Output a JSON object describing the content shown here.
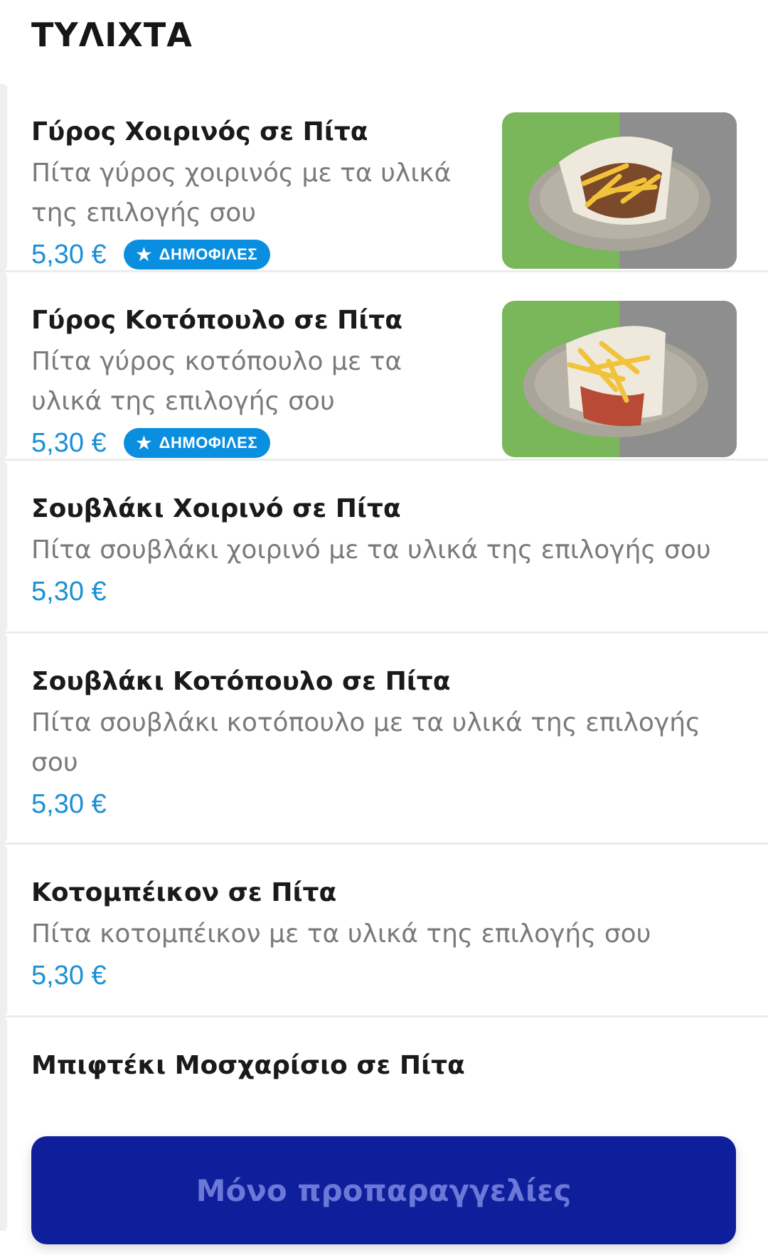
{
  "section": {
    "title": "ΤΥΛΙΧΤΑ"
  },
  "items": [
    {
      "name": "Γύρος Χοιρινός σε Πίτα",
      "description": "Πίτα γύρος χοιρινός με τα υλικά της επιλογής σου",
      "price": "5,30 €",
      "badge": "ΔΗΜΟΦΙΛΕΣ",
      "image": "gyro-pork-pita-photo"
    },
    {
      "name": "Γύρος Κοτόπουλο σε Πίτα",
      "description": "Πίτα γύρος κοτόπουλο με τα υλικά της επιλογής σου",
      "price": "5,30 €",
      "badge": "ΔΗΜΟΦΙΛΕΣ",
      "image": "gyro-chicken-pita-photo"
    },
    {
      "name": "Σουβλάκι Χοιρινό σε Πίτα",
      "description": "Πίτα σουβλάκι χοιρινό με τα υλικά της επιλογής σου",
      "price": "5,30 €"
    },
    {
      "name": "Σουβλάκι Κοτόπουλο σε Πίτα",
      "description": "Πίτα σουβλάκι κοτόπουλο με τα υλικά της επιλογής σου",
      "price": "5,30 €"
    },
    {
      "name": "Κοτομπέικον σε Πίτα",
      "description": "Πίτα κοτομπέικον  με τα υλικά της επιλογής σου",
      "price": "5,30 €"
    },
    {
      "name": "Μπιφτέκι Μοσχαρίσιο σε Πίτα"
    }
  ],
  "cta": {
    "label": "Μόνο προπαραγγελίες"
  },
  "colors": {
    "price": "#1b8fd6",
    "badge": "#0a8fe0",
    "cta_bg": "#0f1e9a",
    "cta_text": "#6b78d8"
  },
  "icons": {
    "badge": "star-icon"
  }
}
